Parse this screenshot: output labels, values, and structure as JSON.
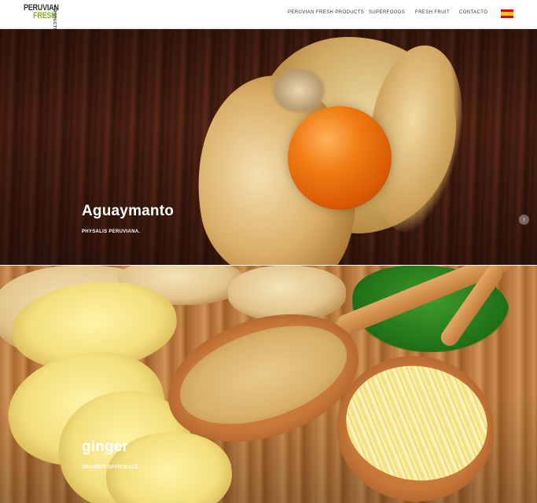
{
  "header": {
    "logo": {
      "line1": "PERUVIAN",
      "line2": "FRESH",
      "line3": "PRODUCTS"
    },
    "nav": [
      {
        "label": "PERUVIAN FRESH PRODUCTS"
      },
      {
        "label": "SUPERFOODS"
      },
      {
        "label": "FRESH FRUIT"
      },
      {
        "label": "CONTACTO"
      }
    ],
    "language_flag": "flag-es-icon",
    "flag_colors": {
      "red": "#c60b1e",
      "yellow": "#ffc400"
    }
  },
  "slides": [
    {
      "title": "Aguaymanto",
      "subtitle": "PHYSALIS PERUVIANA."
    },
    {
      "title": "ginger",
      "subtitle": "ZINGIBER OFFICINALE"
    }
  ],
  "scroll_button": {
    "icon": "arrow-up-icon",
    "glyph": "↑"
  }
}
